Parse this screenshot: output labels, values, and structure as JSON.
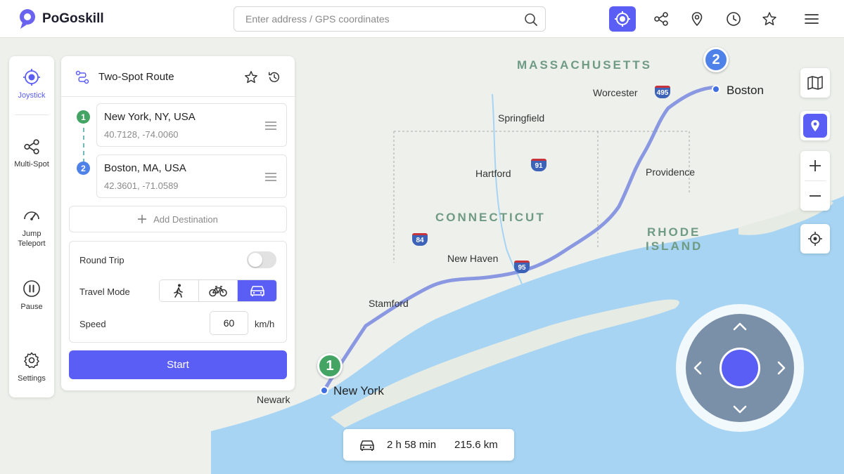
{
  "app": {
    "name": "PoGoskill"
  },
  "search": {
    "placeholder": "Enter address / GPS coordinates",
    "value": ""
  },
  "toolbar": {
    "icons": [
      "joystick-target-icon",
      "multi-spot-icon",
      "location-pin-icon",
      "history-clock-icon",
      "favorite-star-icon",
      "menu-icon"
    ],
    "active": "joystick-target-icon"
  },
  "sidebar": {
    "items": [
      {
        "label": "Joystick",
        "icon": "joystick-icon",
        "active": true
      },
      {
        "label": "Multi-Spot",
        "icon": "multi-spot-icon",
        "active": false
      },
      {
        "label": "Jump Teleport",
        "icon": "jump-teleport-icon",
        "active": false
      },
      {
        "label": "Pause",
        "icon": "pause-icon",
        "active": false
      },
      {
        "label": "Settings",
        "icon": "gear-icon",
        "active": false
      }
    ]
  },
  "panel": {
    "title": "Two-Spot Route",
    "stops": [
      {
        "number": "1",
        "address": "New York, NY, USA",
        "coords": "40.7128, -74.0060"
      },
      {
        "number": "2",
        "address": "Boston, MA, USA",
        "coords": "42.3601, -71.0589"
      }
    ],
    "add_destination": "Add Destination",
    "round_trip_label": "Round Trip",
    "round_trip": false,
    "travel_mode_label": "Travel Mode",
    "travel_modes": [
      "walk",
      "bike",
      "car"
    ],
    "travel_mode_selected": "car",
    "speed_label": "Speed",
    "speed_value": "60",
    "speed_unit": "km/h",
    "start_label": "Start"
  },
  "route_info": {
    "duration": "2 h 58 min",
    "distance": "215.6 km"
  },
  "map": {
    "states": [
      "MASSACHUSETTS",
      "CONNECTICUT",
      "RHODE",
      "ISLAND"
    ],
    "cities": [
      "Boston",
      "Worcester",
      "Springfield",
      "Hartford",
      "Providence",
      "New Haven",
      "Stamford",
      "New York",
      "Newark"
    ],
    "highways": [
      "495",
      "91",
      "84",
      "95"
    ],
    "markers": [
      "1",
      "2"
    ]
  },
  "colors": {
    "accent": "#5b5ef5",
    "start_marker": "#43a463",
    "end_marker": "#4f82e8",
    "route": "#7d8ee0",
    "water": "#a6d4f2",
    "land": "#eef0ec"
  }
}
